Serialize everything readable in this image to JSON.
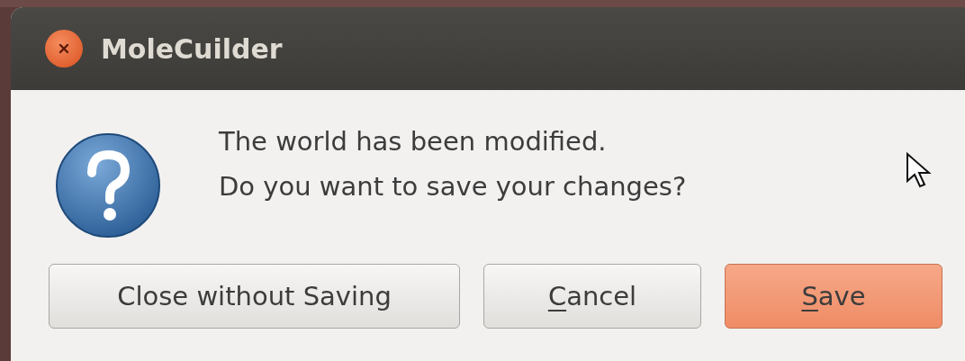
{
  "window": {
    "title": "MoleCuilder"
  },
  "message": {
    "lines": [
      "The world has been modified.",
      "Do you want to save your changes?"
    ]
  },
  "buttons": [
    {
      "label": "Close without Saving",
      "mnemonic": false,
      "default": false
    },
    {
      "label": "Cancel",
      "mnemonic": true,
      "default": false
    },
    {
      "label": "Save",
      "mnemonic": true,
      "default": true
    }
  ]
}
